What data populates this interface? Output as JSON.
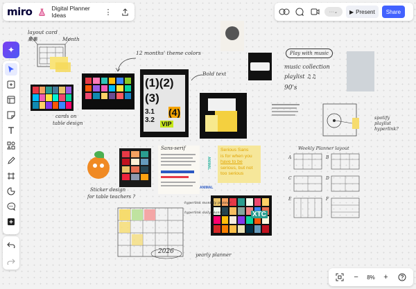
{
  "header": {
    "logo": "miro",
    "board_title": "Digital Planner Ideas"
  },
  "topbar_right": {
    "present_label": "Present",
    "share_label": "Share"
  },
  "zoom": {
    "level": "8%"
  },
  "board_notes": {
    "layout_card": "layout card",
    "layout_sub": "集集",
    "month": "Month",
    "theme_colors": "12 months' theme colors",
    "bold_text": "Bold text",
    "cards_on_table": "cards on",
    "cards_on_table2": "table design",
    "play_music": "Play with music",
    "music_collection": "music collection",
    "playlist": "playlist ♫♫",
    "nineties": "90's",
    "spotify": "spotify",
    "spotify2": "playlist",
    "spotify3": "hyperlink?",
    "weekly_planner": "Weekly Planner layout",
    "sticker_design": "Sticker design",
    "sticker_design2": "for table teachers ?",
    "hyperlink_monthly": "hyperlink monthly planner",
    "hyperlink_daily": "hyperlink daily planner",
    "year_2026": "2026",
    "yearly_planner": "yearly planner",
    "sans_serif": "Sans-serif",
    "animal1": "ANIMAL",
    "animal2": "ANIMAL",
    "serious_sans_1": "Serious Sans",
    "serious_sans_2": "is for when you",
    "serious_sans_3": "have to be",
    "serious_sans_4": "serious, but not",
    "serious_sans_5": "too serious",
    "poster_1": "(1)(2)",
    "poster_2": "(3)",
    "poster_3": "3.1",
    "poster_4": "3.2",
    "poster_5": "(4)",
    "poster_6": "VIP",
    "xtc": "XTC",
    "grid_a": "A",
    "grid_b": "B",
    "grid_c": "C",
    "grid_d": "D",
    "grid_e": "E",
    "grid_f": "F"
  }
}
